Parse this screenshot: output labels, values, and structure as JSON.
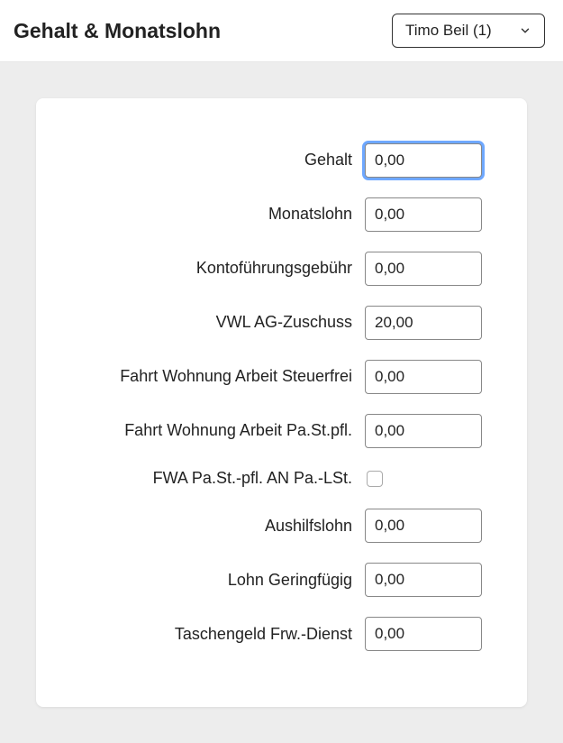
{
  "header": {
    "title": "Gehalt & Monatslohn",
    "dropdown": {
      "selected": "Timo Beil (1)"
    }
  },
  "form": {
    "rows": [
      {
        "label": "Gehalt",
        "value": "0,00",
        "type": "text",
        "focused": true
      },
      {
        "label": "Monatslohn",
        "value": "0,00",
        "type": "text",
        "focused": false
      },
      {
        "label": "Kontoführungsgebühr",
        "value": "0,00",
        "type": "text",
        "focused": false
      },
      {
        "label": "VWL AG-Zuschuss",
        "value": "20,00",
        "type": "text",
        "focused": false
      },
      {
        "label": "Fahrt Wohnung Arbeit Steuerfrei",
        "value": "0,00",
        "type": "text",
        "focused": false
      },
      {
        "label": "Fahrt Wohnung Arbeit Pa.St.pfl.",
        "value": "0,00",
        "type": "text",
        "focused": false
      },
      {
        "label": "FWA Pa.St.-pfl. AN Pa.-LSt.",
        "value": "",
        "type": "checkbox",
        "checked": false
      },
      {
        "label": "Aushilfslohn",
        "value": "0,00",
        "type": "text",
        "focused": false
      },
      {
        "label": "Lohn Geringfügig",
        "value": "0,00",
        "type": "text",
        "focused": false
      },
      {
        "label": "Taschengeld Frw.-Dienst",
        "value": "0,00",
        "type": "text",
        "focused": false
      }
    ]
  }
}
